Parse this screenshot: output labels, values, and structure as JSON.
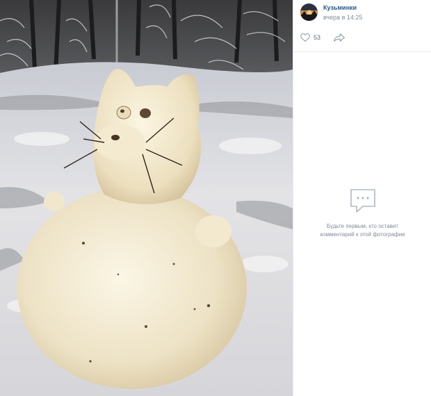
{
  "author": {
    "name": "Кузьминки",
    "time": "вчера в 14:25"
  },
  "actions": {
    "likes": "53",
    "like_icon": "heart-icon",
    "share_icon": "share-arrow-icon"
  },
  "comments": {
    "empty_icon": "comment-bubble-icon",
    "empty_line1": "Будьте первым, кто оставит",
    "empty_line2": "комментарий к этой фотографии"
  },
  "colors": {
    "link": "#2a5885",
    "muted": "#818c99",
    "icon": "#aeb7c2",
    "divider": "#e7e8ec"
  }
}
